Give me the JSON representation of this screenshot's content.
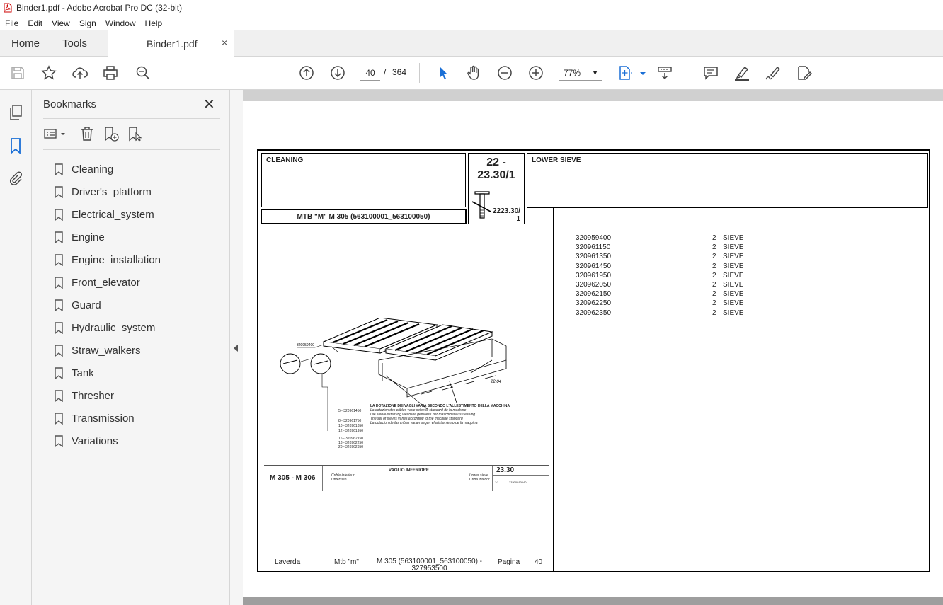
{
  "window": {
    "title": "Binder1.pdf - Adobe Acrobat Pro DC (32-bit)"
  },
  "menu": [
    "File",
    "Edit",
    "View",
    "Sign",
    "Window",
    "Help"
  ],
  "tabs": {
    "home": "Home",
    "tools": "Tools",
    "document": "Binder1.pdf",
    "close": "×"
  },
  "toolbar": {
    "current_page": "40",
    "page_separator": "/",
    "total_pages": "364",
    "zoom": "77%"
  },
  "bookmarks": {
    "title": "Bookmarks",
    "close": "✕",
    "items": [
      "Cleaning",
      "Driver's_platform",
      "Electrical_system",
      "Engine",
      "Engine_installation",
      "Front_elevator",
      "Guard",
      "Hydraulic_system",
      "Straw_walkers",
      "Tank",
      "Thresher",
      "Transmission",
      "Variations"
    ]
  },
  "page": {
    "section": "CLEANING",
    "model_line": "MTB \"M\" M 305 (563100001_563100050)",
    "group_number_1": "22 -",
    "group_number_2": "23.30/1",
    "group_small_1": "2223.30/",
    "group_small_2": "1",
    "part_title": "LOWER SIEVE",
    "parts": [
      {
        "number": "320959400",
        "qty": "2",
        "desc": "SIEVE"
      },
      {
        "number": "320961150",
        "qty": "2",
        "desc": "SIEVE"
      },
      {
        "number": "320961350",
        "qty": "2",
        "desc": "SIEVE"
      },
      {
        "number": "320961450",
        "qty": "2",
        "desc": "SIEVE"
      },
      {
        "number": "320961950",
        "qty": "2",
        "desc": "SIEVE"
      },
      {
        "number": "320962050",
        "qty": "2",
        "desc": "SIEVE"
      },
      {
        "number": "320962150",
        "qty": "2",
        "desc": "SIEVE"
      },
      {
        "number": "320962250",
        "qty": "2",
        "desc": "SIEVE"
      },
      {
        "number": "320962350",
        "qty": "2",
        "desc": "SIEVE"
      }
    ],
    "drawing": {
      "callout_main": "320959400",
      "callout_ref": "22.04",
      "legend_lines": [
        "LA DOTAZIONE DEI VAGLI VARIA SECONDO L'ALLESTIMENTO DELLA MACCHINA",
        "La dotazion des cribles varie selon le standard de la machine",
        "Die siebausstattung wechselt gemaess der maschinenausruestung",
        "The set of sieves varies according to the machine standard",
        "La dotacion de las cribas varian segun el alistamiento de la maquina"
      ],
      "variant_labels": [
        "5 - 320961450",
        "8 - 320961750",
        "10 - 320961850",
        "12 - 320961950",
        "16 - 320962150",
        "18 - 320962250",
        "20 - 320962350"
      ]
    },
    "title_block": {
      "models": "M 305 - M 306",
      "description": "VAGLIO INFERIORE",
      "sub_left_1": "Crible inferieur",
      "sub_left_2": "Untersieb",
      "sub_right_1": "Lower sieve",
      "sub_right_2": "Criba inferior",
      "code": "23.30",
      "ratio": "1/1",
      "ref": "23300010040"
    },
    "footer": {
      "brand": "Laverda",
      "line": "Mtb \"m\"",
      "model_1": "M 305 (563100001_563100050)  -",
      "model_2": "327953500",
      "page_label": "Pagina",
      "page_number": "40"
    }
  }
}
